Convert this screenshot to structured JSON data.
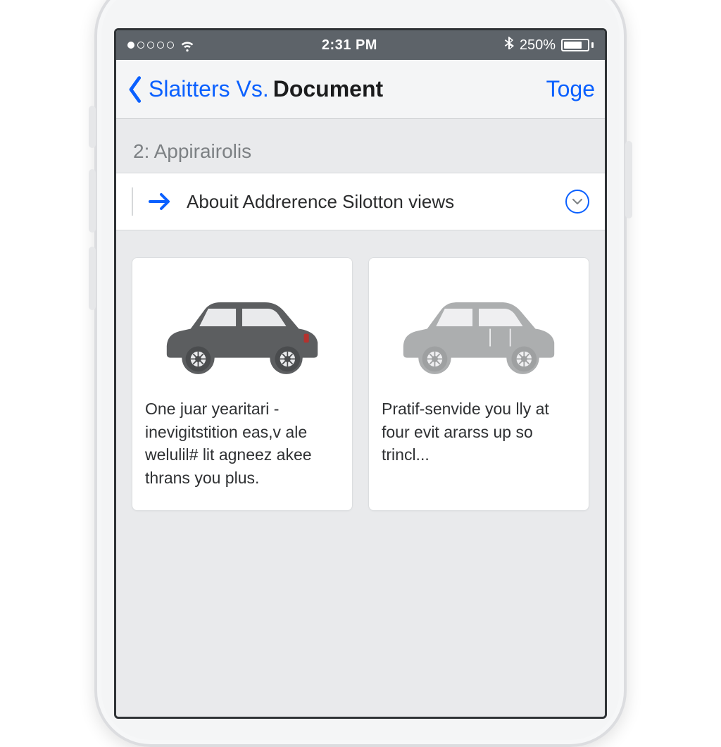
{
  "status_bar": {
    "time": "2:31 PM",
    "battery_percent": "250%",
    "signal_filled_dots": 1,
    "signal_total_dots": 5
  },
  "nav": {
    "back_prefix": "Slaitters Vs.",
    "title_bold": "Document",
    "action_label": "Toge"
  },
  "section": {
    "header": "2: Appirairolis",
    "row_label": "Abouit Addrerence Silotton views"
  },
  "cards": [
    {
      "icon": "car-icon",
      "caption": "One juar yearitari - inevigitstition eas,v ale welulil# lit agneez akee thrans you plus."
    },
    {
      "icon": "car-icon",
      "caption": "Pratif-senvide you lly at four evit ararss up so trincl..."
    }
  ]
}
